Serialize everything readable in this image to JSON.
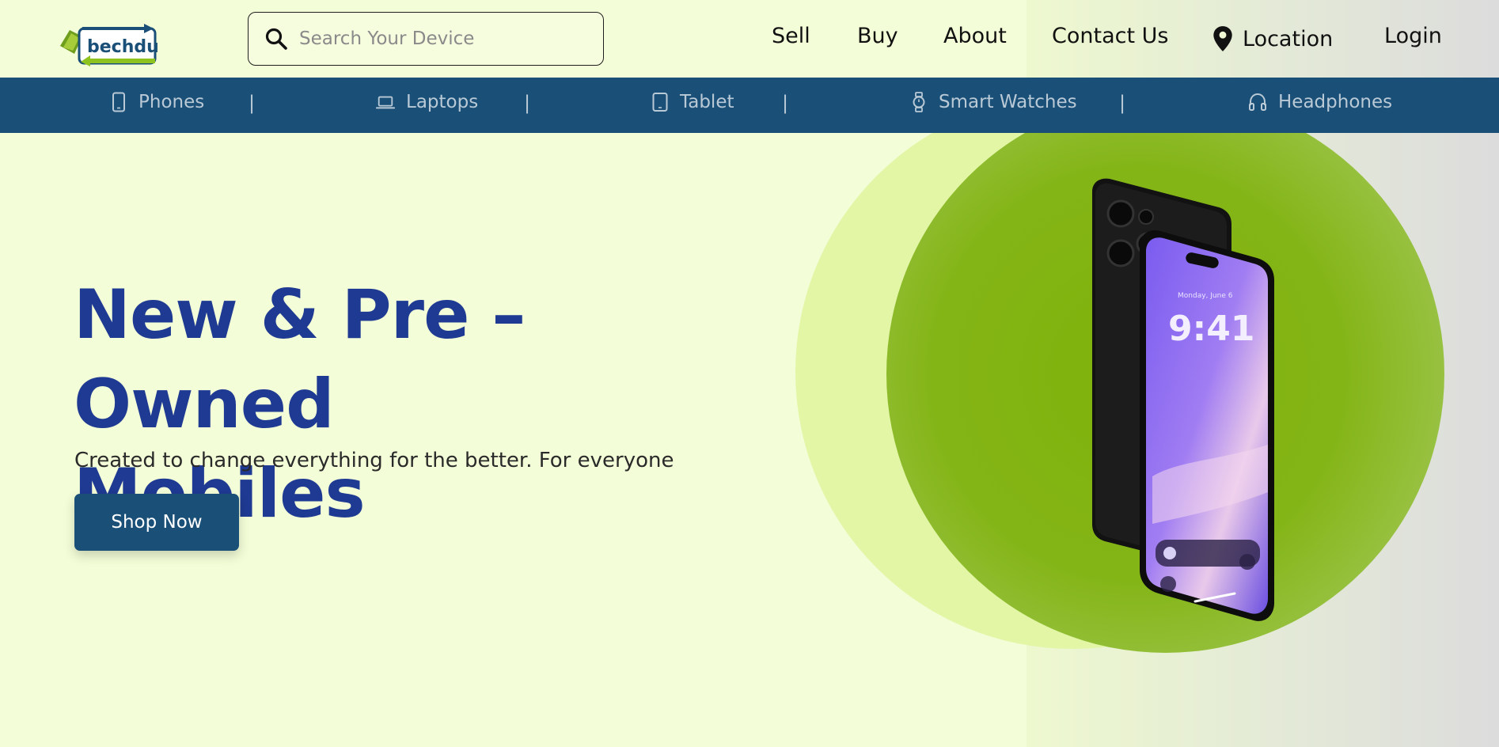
{
  "header": {
    "logo_text": "bechdu",
    "search_placeholder": "Search Your Device",
    "nav": {
      "sell": "Sell",
      "buy": "Buy",
      "about": "About",
      "contact": "Contact Us",
      "location": "Location",
      "login": "Login"
    }
  },
  "categories": {
    "phones": "Phones",
    "laptops": "Laptops",
    "tablet": "Tablet",
    "smart_watches": "Smart Watches",
    "headphones": "Headphones",
    "separator": "|"
  },
  "hero": {
    "title_line1": "New & Pre – Owned",
    "title_line2": "Mobiles",
    "subtitle": "Created to change everything for the better. For everyone",
    "cta": "Shop Now"
  },
  "phone_screen": {
    "date": "Monday, June 6",
    "time": "9:41"
  },
  "colors": {
    "page_bg": "#f3fdd7",
    "brand_blue": "#1a4f77",
    "title_blue": "#1f3a93",
    "accent_green": "#7fb20a"
  }
}
